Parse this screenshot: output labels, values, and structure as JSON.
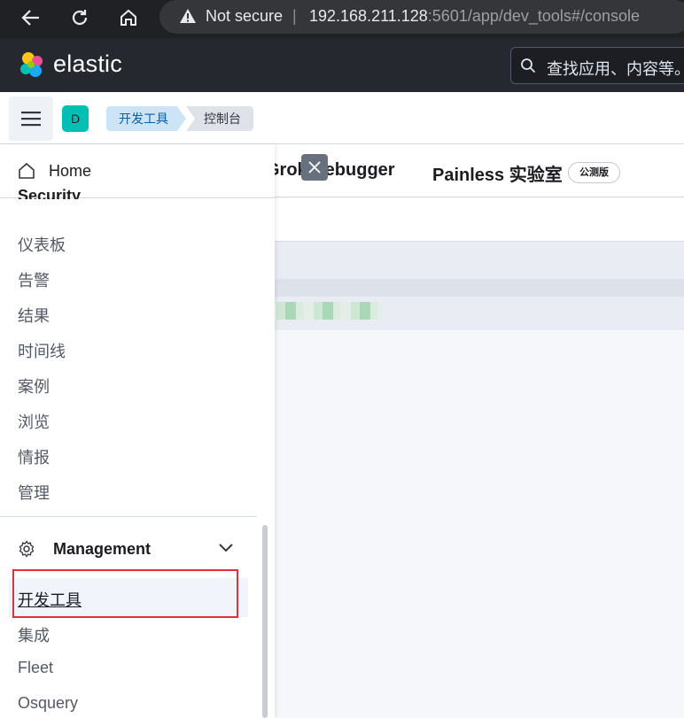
{
  "browser": {
    "security_label": "Not secure",
    "url_host": "192.168.211.128",
    "url_rest": ":5601/app/dev_tools#/console"
  },
  "header": {
    "brand": "elastic",
    "search_placeholder": "查找应用、内容等。"
  },
  "breadcrumbs": {
    "space_initial": "D",
    "items": [
      "开发工具",
      "控制台"
    ]
  },
  "tabs": {
    "grok": "Grok Debugger",
    "painless": "Painless 实验室",
    "beta": "公测版"
  },
  "nav": {
    "home": "Home",
    "security_heading": "Security",
    "security_items": [
      "仪表板",
      "告警",
      "结果",
      "时间线",
      "案例",
      "浏览",
      "情报",
      "管理"
    ],
    "management_heading": "Management",
    "management_items": [
      "开发工具",
      "集成",
      "Fleet",
      "Osquery"
    ]
  },
  "colors": {
    "accent": "#0061a6",
    "highlight_box": "#e0303a",
    "header_bg": "#25282f"
  }
}
